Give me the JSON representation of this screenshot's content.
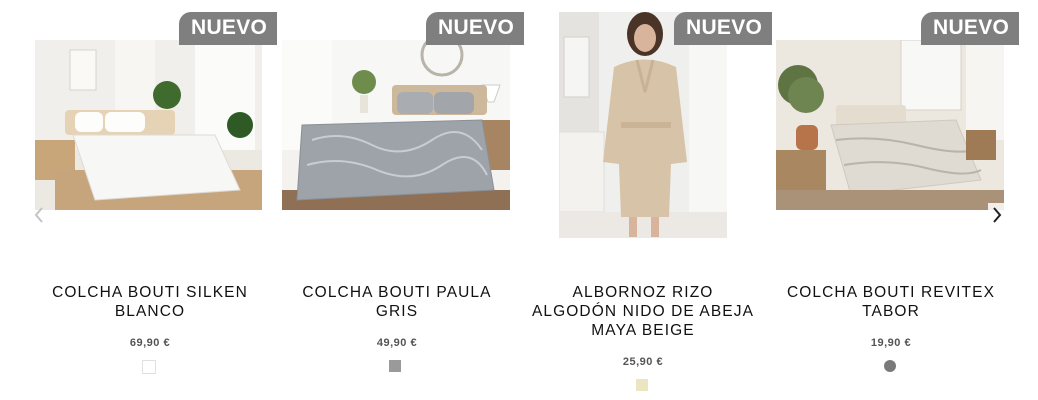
{
  "products": [
    {
      "badge": "NUEVO",
      "title_line1": "COLCHA BOUTI SILKEN",
      "title_line2": "BLANCO",
      "title_line3": "",
      "price": "69,90 €",
      "swatch_color": "#ffffff"
    },
    {
      "badge": "NUEVO",
      "title_line1": "COLCHA BOUTI PAULA",
      "title_line2": "GRIS",
      "title_line3": "",
      "price": "49,90 €",
      "swatch_color": "#9a9a9a"
    },
    {
      "badge": "NUEVO",
      "title_line1": "ALBORNOZ RIZO",
      "title_line2": "ALGODÓN NIDO DE ABEJA",
      "title_line3": "MAYA BEIGE",
      "price": "25,90 €",
      "swatch_color": "#ece6c0"
    },
    {
      "badge": "NUEVO",
      "title_line1": "COLCHA BOUTI REVITEX",
      "title_line2": "TABOR",
      "title_line3": "",
      "price": "19,90 €",
      "swatch_color": "#7a7a7a"
    }
  ],
  "nav": {
    "prev_icon": "chevron-left-icon",
    "next_icon": "chevron-right-icon"
  },
  "colors": {
    "badge_bg": "#7f7f7f",
    "badge_text": "#ffffff"
  }
}
